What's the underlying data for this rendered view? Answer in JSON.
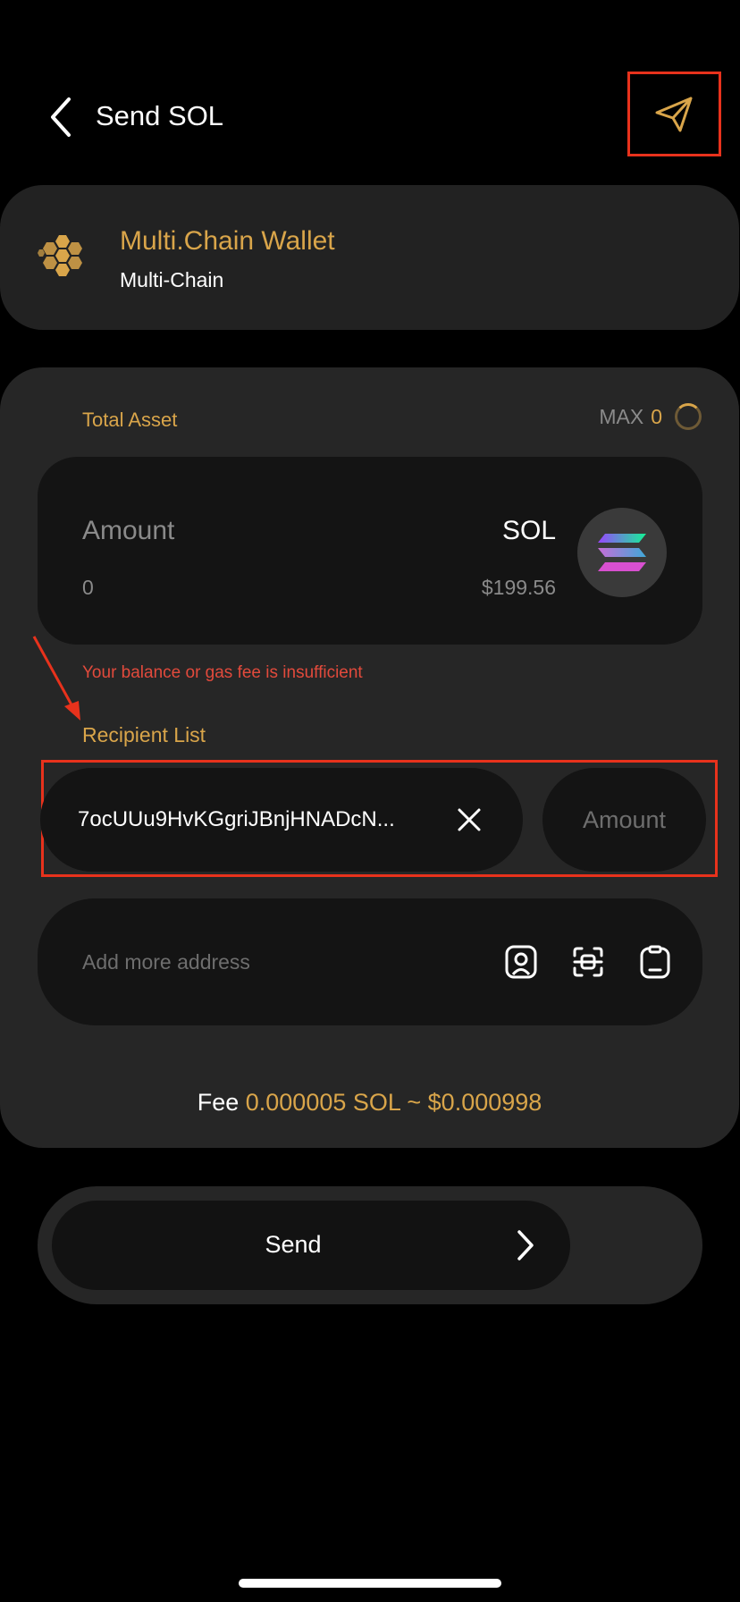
{
  "header": {
    "title": "Send SOL"
  },
  "wallet": {
    "name": "Multi.Chain Wallet",
    "subtitle": "Multi-Chain"
  },
  "asset": {
    "total_label": "Total Asset",
    "max_label": "MAX",
    "max_value": "0"
  },
  "amount_input": {
    "placeholder": "Amount",
    "value": "0",
    "token_symbol": "SOL",
    "token_usd": "$199.56"
  },
  "error": {
    "message": "Your balance or gas fee is insufficient"
  },
  "recipients": {
    "label": "Recipient List",
    "items": [
      {
        "address": "7ocUUu9HvKGgriJBnjHNADcN...",
        "amount_placeholder": "Amount"
      }
    ],
    "add_placeholder": "Add more address"
  },
  "fee": {
    "label": "Fee",
    "value": "0.000005 SOL ~ $0.000998"
  },
  "send": {
    "label": "Send"
  },
  "colors": {
    "accent": "#d9a54a",
    "error": "#e24a3c",
    "annotation": "#e8321c",
    "card_bg": "#262626",
    "field_bg": "#141414"
  },
  "icons": [
    "back-chevron-icon",
    "send-paper-plane-icon",
    "wallet-hexagon-logo-icon",
    "loading-spinner-icon",
    "solana-logo-icon",
    "close-x-icon",
    "contact-book-icon",
    "scan-qr-icon",
    "paste-clipboard-icon",
    "chevron-right-icon"
  ]
}
